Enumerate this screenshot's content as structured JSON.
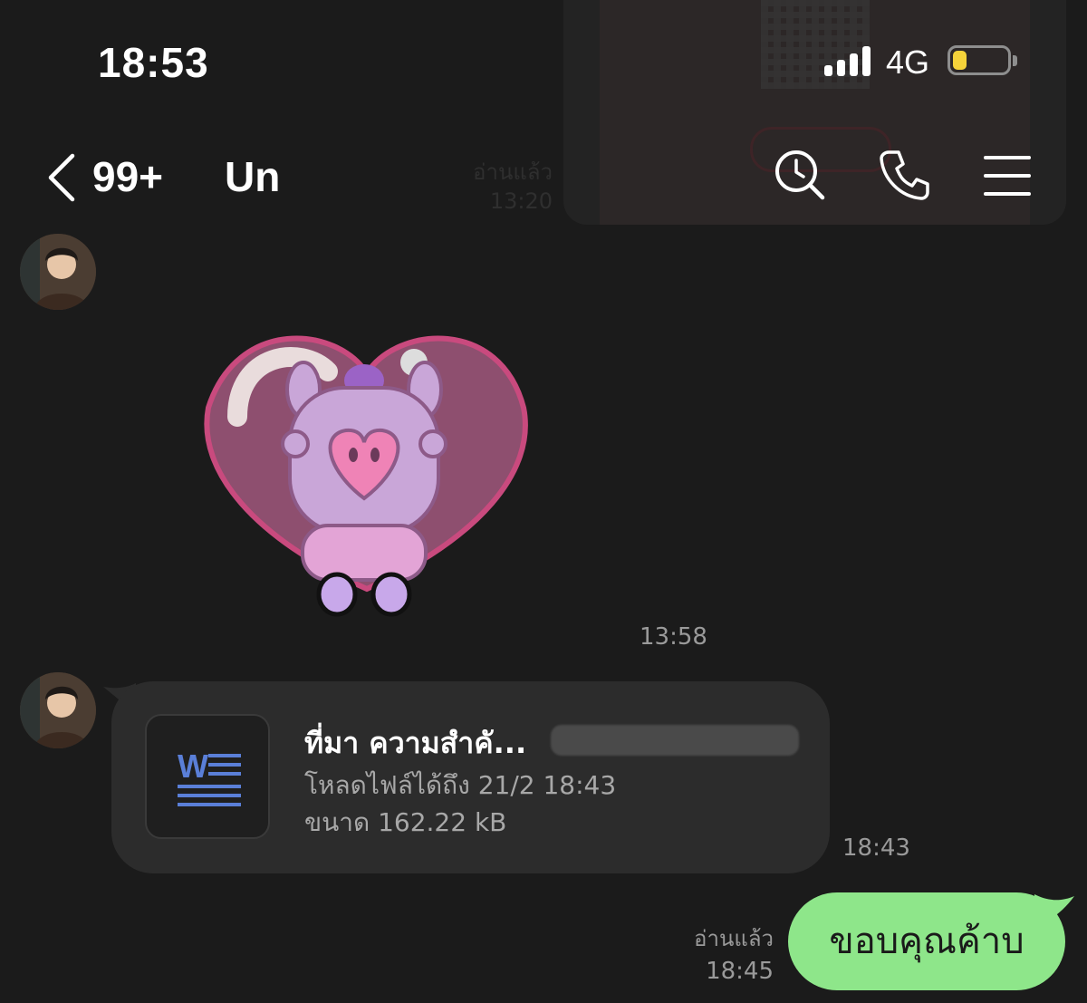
{
  "status_bar": {
    "time": "18:53",
    "network": "4G",
    "battery_level": 0.25,
    "battery_color": "#f5d33a"
  },
  "header": {
    "unread_count": "99+",
    "chat_name": "Un",
    "icons": [
      "back-icon",
      "search-history-icon",
      "phone-icon",
      "menu-icon"
    ]
  },
  "background": {
    "read_label": "อ่านแล้ว",
    "read_time": "13:20"
  },
  "messages": [
    {
      "type": "sticker",
      "time": "13:58"
    },
    {
      "type": "file",
      "file_name": "ที่มา ความสำคั...",
      "expiry_line": "โหลดไฟล์ได้ถึง 21/2 18:43",
      "size_line": "ขนาด 162.22 kB",
      "time": "18:43"
    },
    {
      "type": "text_outgoing",
      "text": "ขอบคุณค้าบ",
      "read_label": "อ่านแล้ว",
      "time": "18:45",
      "bubble_color": "#8ee68a"
    }
  ]
}
